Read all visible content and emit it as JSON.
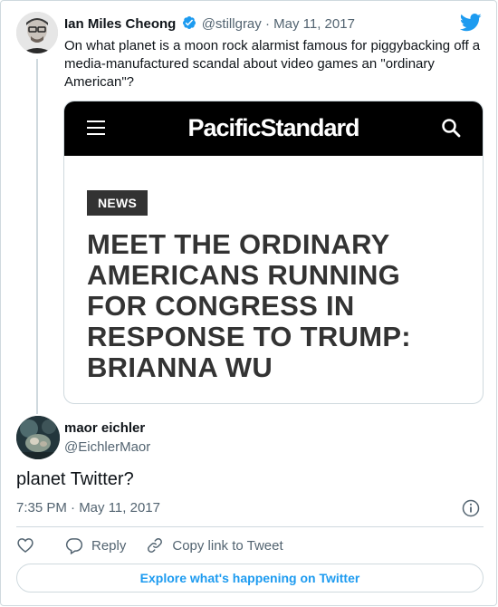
{
  "colors": {
    "accent": "#1d9bf0",
    "text": "#0f1419",
    "muted": "#536471",
    "border": "#cfd9de",
    "ps_bar": "#000000",
    "badge": "#333333"
  },
  "tweet": {
    "author_name": "Ian Miles Cheong",
    "author_handle": "@stillgray",
    "separator": "·",
    "date": "May 11, 2017",
    "text": "On what planet is a moon rock alarmist famous for piggybacking off a media-manufactured scandal about video games an \"ordinary American\"?",
    "embed": {
      "brand": "PacificStandard",
      "badge": "NEWS",
      "headline": "MEET THE ORDINARY AMERICANS RUNNING FOR CONGRESS IN RESPONSE TO TRUMP: BRIANNA WU"
    }
  },
  "reply": {
    "author_name": "maor eichler",
    "author_handle": "@EichlerMaor",
    "text": "planet Twitter?",
    "timestamp": "7:35 PM · May 11, 2017"
  },
  "actions": {
    "reply_label": "Reply",
    "copy_label": "Copy link to Tweet"
  },
  "explore_label": "Explore what's happening on Twitter"
}
